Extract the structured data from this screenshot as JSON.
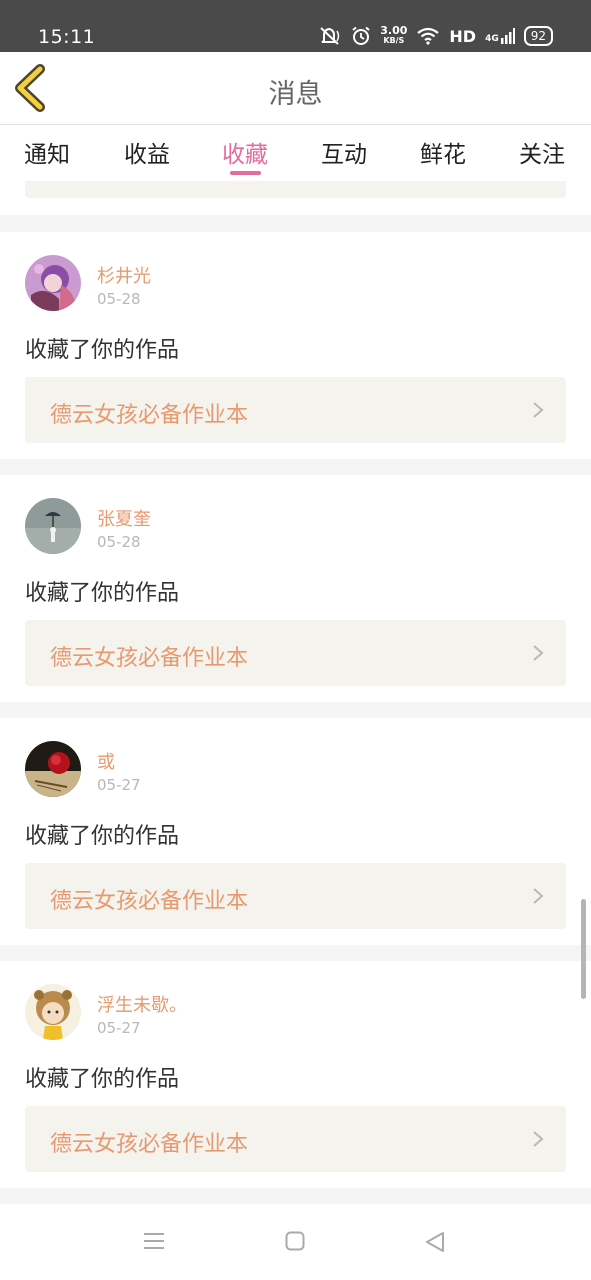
{
  "status_bar": {
    "time": "15:11",
    "net_speed": "3.00",
    "net_unit": "KB/S",
    "hd": "HD",
    "network": "4G",
    "battery": "92"
  },
  "header": {
    "title": "消息"
  },
  "tabs": [
    {
      "label": "通知"
    },
    {
      "label": "收益"
    },
    {
      "label": "收藏",
      "active": true
    },
    {
      "label": "互动"
    },
    {
      "label": "鲜花"
    },
    {
      "label": "关注"
    }
  ],
  "items": [
    {
      "user": "杉井光",
      "date": "05-28",
      "action": "收藏了你的作品",
      "work": "德云女孩必备作业本"
    },
    {
      "user": "张夏奎",
      "date": "05-28",
      "action": "收藏了你的作品",
      "work": "德云女孩必备作业本"
    },
    {
      "user": "或",
      "date": "05-27",
      "action": "收藏了你的作品",
      "work": "德云女孩必备作业本"
    },
    {
      "user": "浮生未歇。",
      "date": "05-27",
      "action": "收藏了你的作品",
      "work": "德云女孩必备作业本"
    }
  ],
  "colors": {
    "accent": "#e46c9d",
    "username": "#e79a6f",
    "link_bg": "#f4f3ee",
    "status_bar": "#4a4a4a"
  },
  "icons": [
    "back-icon",
    "mute-icon",
    "alarm-icon",
    "wifi-icon",
    "signal-icon",
    "chevron-right-icon",
    "menu-icon",
    "home-icon",
    "back-triangle-icon"
  ]
}
